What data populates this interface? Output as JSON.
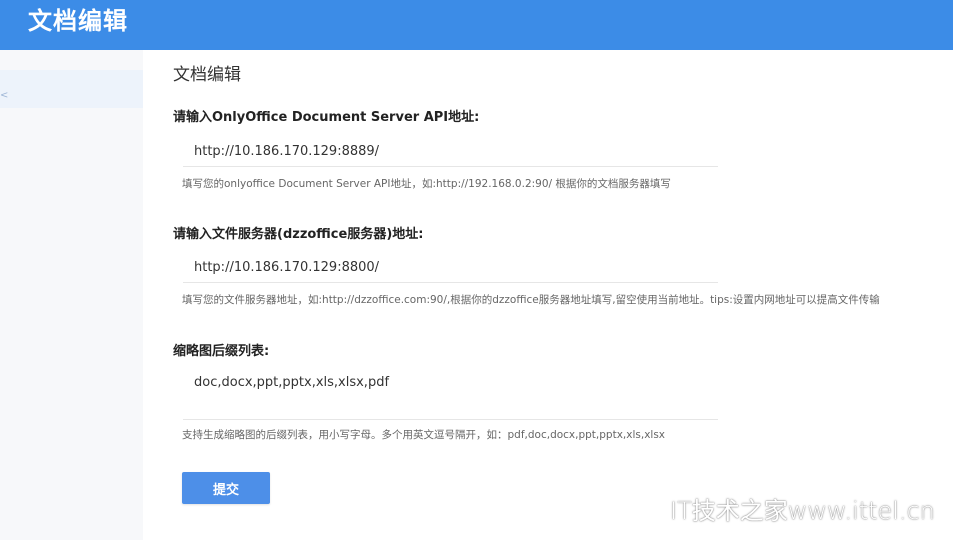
{
  "header": {
    "app_title": "文档编辑"
  },
  "sidebar": {
    "active_marker": "<"
  },
  "main": {
    "page_title": "文档编辑",
    "fields": [
      {
        "label": "请输入OnlyOffice Document Server API地址:",
        "value": "http://10.186.170.129:8889/",
        "help": "填写您的onlyoffice Document Server API地址，如:http://192.168.0.2:90/ 根据你的文档服务器填写"
      },
      {
        "label": "请输入文件服务器(dzzoffice服务器)地址:",
        "value": "http://10.186.170.129:8800/",
        "help": "填写您的文件服务器地址，如:http://dzzoffice.com:90/,根据你的dzzoffice服务器地址填写,留空使用当前地址。tips:设置内网地址可以提高文件传输"
      },
      {
        "label": "缩略图后缀列表:",
        "value": "doc,docx,ppt,pptx,xls,xlsx,pdf",
        "help": "支持生成缩略图的后缀列表，用小写字母。多个用英文逗号隔开，如：pdf,doc,docx,ppt,pptx,xls,xlsx"
      }
    ],
    "submit_label": "提交"
  },
  "watermark": "IT技术之家www.ittel.cn",
  "colors": {
    "header_bg": "#3c8ce7",
    "button_bg": "#4d8fe8"
  }
}
